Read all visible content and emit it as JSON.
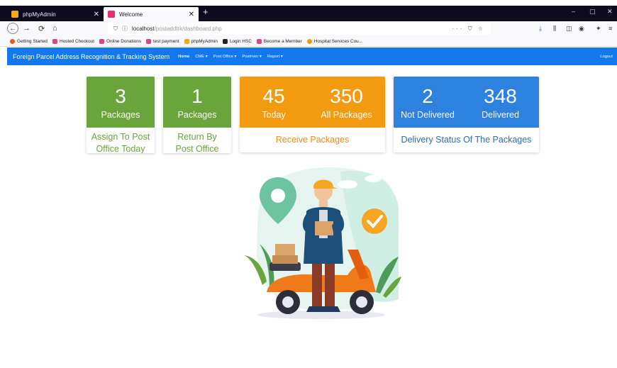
{
  "browser": {
    "tabs": [
      {
        "label": "phpMyAdmin",
        "close": "✕"
      },
      {
        "label": "Welcome",
        "close": "✕"
      }
    ],
    "new_tab": "+",
    "window_controls": [
      "–",
      "▢",
      "✕"
    ],
    "url_host": "localhost",
    "url_path": "/postaddtrk/dashboard.php",
    "url_page_actions": "··· ⛉ ☆",
    "bookmarks": [
      {
        "label": "Getting Started",
        "color": "#e8562a"
      },
      {
        "label": "Hosted Checkout",
        "color": "#d34a8b"
      },
      {
        "label": "Online Donations",
        "color": "#d34a8b"
      },
      {
        "label": "test payment",
        "color": "#d34a8b"
      },
      {
        "label": "phpMyAdmin",
        "color": "#f2a81d"
      },
      {
        "label": "Login HSC",
        "color": "#222222"
      },
      {
        "label": "Become a Member",
        "color": "#d34a8b"
      },
      {
        "label": "Hospital Services Cou...",
        "color": "#e69a12"
      }
    ]
  },
  "navbar": {
    "brand": "Foreign Parcel Address Recognition & Tracking System",
    "menu": [
      "Home",
      "CME ▾",
      "Post Office ▾",
      "Postmen ▾",
      "Report ▾"
    ],
    "logout": "Logout",
    "color": "#1378ee"
  },
  "cards": {
    "assign": {
      "number": "3",
      "label": "Packages",
      "caption": "Assign To Post Office Today"
    },
    "return": {
      "number": "1",
      "label": "Packages",
      "caption": "Return By Post Office"
    },
    "receive": {
      "today_number": "45",
      "today_label": "Today",
      "all_number": "350",
      "all_label": "All Packages",
      "caption": "Receive Packages"
    },
    "delivery": {
      "not_delivered_number": "2",
      "not_delivered_label": "Not Delivered",
      "delivered_number": "348",
      "delivered_label": "Delivered",
      "caption": "Delivery Status Of The Packages"
    }
  },
  "colors": {
    "green": "#6aa53c",
    "orange": "#f29b11",
    "blue": "#2e82df"
  }
}
